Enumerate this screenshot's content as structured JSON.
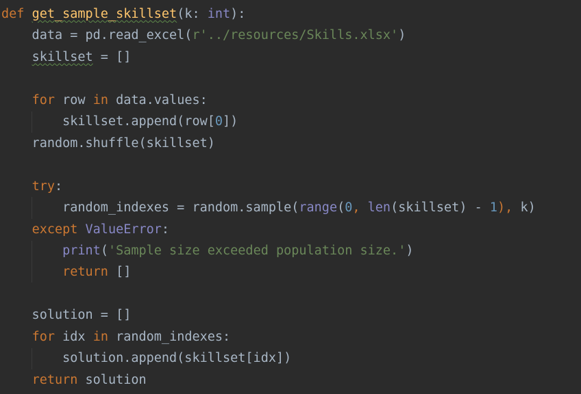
{
  "code": {
    "lines": [
      [
        {
          "text": "def ",
          "type": "kw"
        },
        {
          "text": "get_sample_skillset",
          "type": "fn",
          "squiggle": true
        },
        {
          "text": "(k: ",
          "type": "plain"
        },
        {
          "text": "int",
          "type": "bi"
        },
        {
          "text": "):",
          "type": "plain"
        }
      ],
      [
        {
          "text": "    data = pd.read_excel(",
          "type": "plain"
        },
        {
          "text": "r'../resources/Skills.xlsx'",
          "type": "str"
        },
        {
          "text": ")",
          "type": "plain"
        }
      ],
      [
        {
          "text": "    ",
          "type": "plain"
        },
        {
          "text": "skillset",
          "type": "plain",
          "squiggle": true
        },
        {
          "text": " = []",
          "type": "plain"
        }
      ],
      [],
      [
        {
          "text": "    ",
          "type": "plain"
        },
        {
          "text": "for ",
          "type": "kw"
        },
        {
          "text": "row ",
          "type": "plain"
        },
        {
          "text": "in ",
          "type": "kw"
        },
        {
          "text": "data.values:",
          "type": "plain"
        }
      ],
      [
        {
          "text": "        skillset.append(row[",
          "type": "plain"
        },
        {
          "text": "0",
          "type": "num"
        },
        {
          "text": "])",
          "type": "plain"
        }
      ],
      [
        {
          "text": "    random.shuffle(skillset)",
          "type": "plain"
        }
      ],
      [],
      [
        {
          "text": "    ",
          "type": "plain"
        },
        {
          "text": "try",
          "type": "kw"
        },
        {
          "text": ":",
          "type": "plain"
        }
      ],
      [
        {
          "text": "        random_indexes = random.sample(",
          "type": "plain"
        },
        {
          "text": "range",
          "type": "bi"
        },
        {
          "text": "(",
          "type": "plain"
        },
        {
          "text": "0",
          "type": "num"
        },
        {
          "text": ", ",
          "type": "kw"
        },
        {
          "text": "len",
          "type": "bi"
        },
        {
          "text": "(skillset) - ",
          "type": "plain"
        },
        {
          "text": "1",
          "type": "num"
        },
        {
          "text": "), ",
          "type": "kw"
        },
        {
          "text": "k)",
          "type": "plain"
        }
      ],
      [
        {
          "text": "    ",
          "type": "plain"
        },
        {
          "text": "except ",
          "type": "kw"
        },
        {
          "text": "ValueError",
          "type": "bi"
        },
        {
          "text": ":",
          "type": "plain"
        }
      ],
      [
        {
          "text": "        ",
          "type": "plain"
        },
        {
          "text": "print",
          "type": "bi"
        },
        {
          "text": "(",
          "type": "plain"
        },
        {
          "text": "'Sample size exceeded population size.'",
          "type": "str"
        },
        {
          "text": ")",
          "type": "plain"
        }
      ],
      [
        {
          "text": "        ",
          "type": "plain"
        },
        {
          "text": "return ",
          "type": "kw"
        },
        {
          "text": "[]",
          "type": "plain"
        }
      ],
      [],
      [
        {
          "text": "    solution = []",
          "type": "plain"
        }
      ],
      [
        {
          "text": "    ",
          "type": "plain"
        },
        {
          "text": "for ",
          "type": "kw"
        },
        {
          "text": "idx ",
          "type": "plain"
        },
        {
          "text": "in ",
          "type": "kw"
        },
        {
          "text": "random_indexes:",
          "type": "plain"
        }
      ],
      [
        {
          "text": "        solution.append(skillset[idx])",
          "type": "plain"
        }
      ],
      [
        {
          "text": "    ",
          "type": "plain"
        },
        {
          "text": "return ",
          "type": "kw"
        },
        {
          "text": "solution",
          "type": "plain"
        }
      ]
    ]
  },
  "colors": {
    "background": "#2b2b2b",
    "keyword": "#cc7832",
    "function": "#ffc66d",
    "builtin": "#8888c6",
    "number": "#6897bb",
    "string": "#6a8759",
    "plain": "#a9b7c6"
  }
}
